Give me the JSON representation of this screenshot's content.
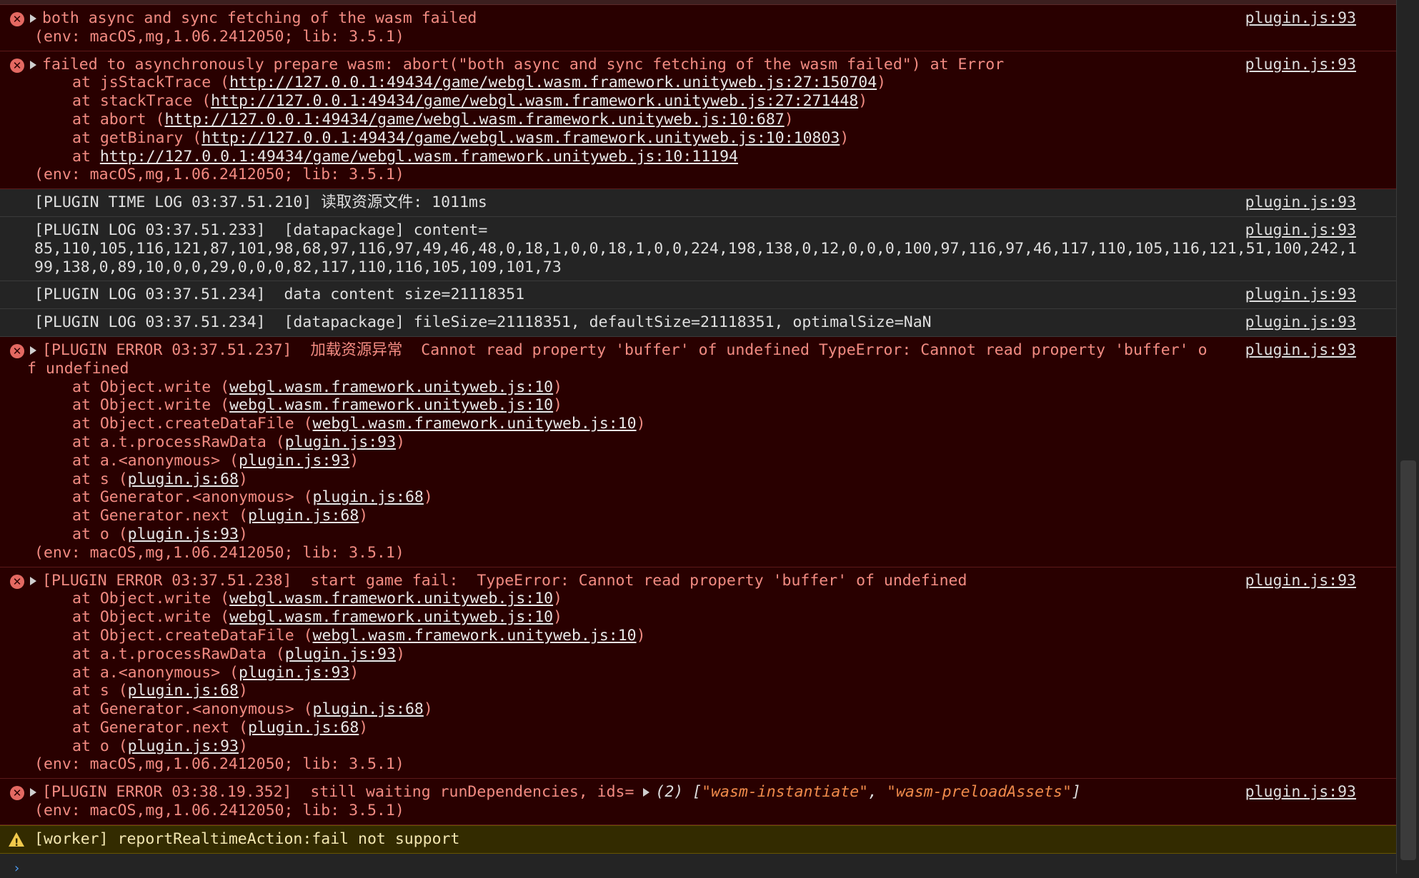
{
  "entries": [
    {
      "level": "error",
      "message": "both async and sync fetching of the wasm failed",
      "env": "(env: macOS,mg,1.06.2412050; lib: 3.5.1)",
      "source": "plugin.js:93"
    },
    {
      "level": "error",
      "message": "failed to asynchronously prepare wasm: abort(\"both async and sync fetching of the wasm failed\") at Error",
      "stack": [
        {
          "prefix": "at jsStackTrace (",
          "link": "http://127.0.0.1:49434/game/webgl.wasm.framework.unityweb.js:27:150704",
          "suffix": ")"
        },
        {
          "prefix": "at stackTrace (",
          "link": "http://127.0.0.1:49434/game/webgl.wasm.framework.unityweb.js:27:271448",
          "suffix": ")"
        },
        {
          "prefix": "at abort (",
          "link": "http://127.0.0.1:49434/game/webgl.wasm.framework.unityweb.js:10:687",
          "suffix": ")"
        },
        {
          "prefix": "at getBinary (",
          "link": "http://127.0.0.1:49434/game/webgl.wasm.framework.unityweb.js:10:10803",
          "suffix": ")"
        },
        {
          "prefix": "at ",
          "link": "http://127.0.0.1:49434/game/webgl.wasm.framework.unityweb.js:10:11194",
          "suffix": ""
        }
      ],
      "env": "(env: macOS,mg,1.06.2412050; lib: 3.5.1)",
      "source": "plugin.js:93"
    },
    {
      "level": "log",
      "message": "[PLUGIN TIME LOG 03:37.51.210] 读取资源文件: 1011ms",
      "source": "plugin.js:93"
    },
    {
      "level": "log",
      "message": "[PLUGIN LOG 03:37.51.233]  [datapackage] content=\n85,110,105,116,121,87,101,98,68,97,116,97,49,46,48,0,18,1,0,0,18,1,0,0,224,198,138,0,12,0,0,0,100,97,116,97,46,117,110,105,116,121,51,100,242,199,138,0,89,10,0,0,29,0,0,0,82,117,110,116,105,109,101,73",
      "source": "plugin.js:93"
    },
    {
      "level": "log",
      "message": "[PLUGIN LOG 03:37.51.234]  data content size=21118351",
      "source": "plugin.js:93"
    },
    {
      "level": "log",
      "message": "[PLUGIN LOG 03:37.51.234]  [datapackage] fileSize=21118351, defaultSize=21118351, optimalSize=NaN",
      "source": "plugin.js:93"
    },
    {
      "level": "error",
      "message": "[PLUGIN ERROR 03:37.51.237]  加载资源异常  Cannot read property 'buffer' of undefined TypeError: Cannot read property 'buffer' of undefined",
      "stack": [
        {
          "prefix": "at Object.write (",
          "link": "webgl.wasm.framework.unityweb.js:10",
          "suffix": ")"
        },
        {
          "prefix": "at Object.write (",
          "link": "webgl.wasm.framework.unityweb.js:10",
          "suffix": ")"
        },
        {
          "prefix": "at Object.createDataFile (",
          "link": "webgl.wasm.framework.unityweb.js:10",
          "suffix": ")"
        },
        {
          "prefix": "at a.t.processRawData (",
          "link": "plugin.js:93",
          "suffix": ")"
        },
        {
          "prefix": "at a.<anonymous> (",
          "link": "plugin.js:93",
          "suffix": ")"
        },
        {
          "prefix": "at s (",
          "link": "plugin.js:68",
          "suffix": ")"
        },
        {
          "prefix": "at Generator.<anonymous> (",
          "link": "plugin.js:68",
          "suffix": ")"
        },
        {
          "prefix": "at Generator.next (",
          "link": "plugin.js:68",
          "suffix": ")"
        },
        {
          "prefix": "at o (",
          "link": "plugin.js:93",
          "suffix": ")"
        }
      ],
      "env": "(env: macOS,mg,1.06.2412050; lib: 3.5.1)",
      "source": "plugin.js:93"
    },
    {
      "level": "error",
      "message": "[PLUGIN ERROR 03:37.51.238]  start game fail:  TypeError: Cannot read property 'buffer' of undefined",
      "stack": [
        {
          "prefix": "at Object.write (",
          "link": "webgl.wasm.framework.unityweb.js:10",
          "suffix": ")"
        },
        {
          "prefix": "at Object.write (",
          "link": "webgl.wasm.framework.unityweb.js:10",
          "suffix": ")"
        },
        {
          "prefix": "at Object.createDataFile (",
          "link": "webgl.wasm.framework.unityweb.js:10",
          "suffix": ")"
        },
        {
          "prefix": "at a.t.processRawData (",
          "link": "plugin.js:93",
          "suffix": ")"
        },
        {
          "prefix": "at a.<anonymous> (",
          "link": "plugin.js:93",
          "suffix": ")"
        },
        {
          "prefix": "at s (",
          "link": "plugin.js:68",
          "suffix": ")"
        },
        {
          "prefix": "at Generator.<anonymous> (",
          "link": "plugin.js:68",
          "suffix": ")"
        },
        {
          "prefix": "at Generator.next (",
          "link": "plugin.js:68",
          "suffix": ")"
        },
        {
          "prefix": "at o (",
          "link": "plugin.js:93",
          "suffix": ")"
        }
      ],
      "env": "(env: macOS,mg,1.06.2412050; lib: 3.5.1)",
      "source": "plugin.js:93"
    },
    {
      "level": "error",
      "message": "[PLUGIN ERROR 03:38.19.352]  still waiting runDependencies, ids= ",
      "array_preview": {
        "count": "(2)",
        "open": "[",
        "items": [
          "\"wasm-instantiate\"",
          "\"wasm-preloadAssets\""
        ],
        "sep": ", ",
        "close": "]"
      },
      "env": "(env: macOS,mg,1.06.2412050; lib: 3.5.1)",
      "source": "plugin.js:93"
    },
    {
      "level": "warn",
      "message": "[worker] reportRealtimeAction:fail not support"
    }
  ],
  "colors": {
    "error_bg": "#290000",
    "error_text": "#f28b82",
    "warn_bg": "#332b00",
    "log_bg": "#242424",
    "string_color": "#f08a4b"
  },
  "icons": {
    "error": "error-circle-icon",
    "warn": "warning-triangle-icon",
    "expand": "expand-triangle-icon",
    "prompt": "console-prompt-icon"
  }
}
